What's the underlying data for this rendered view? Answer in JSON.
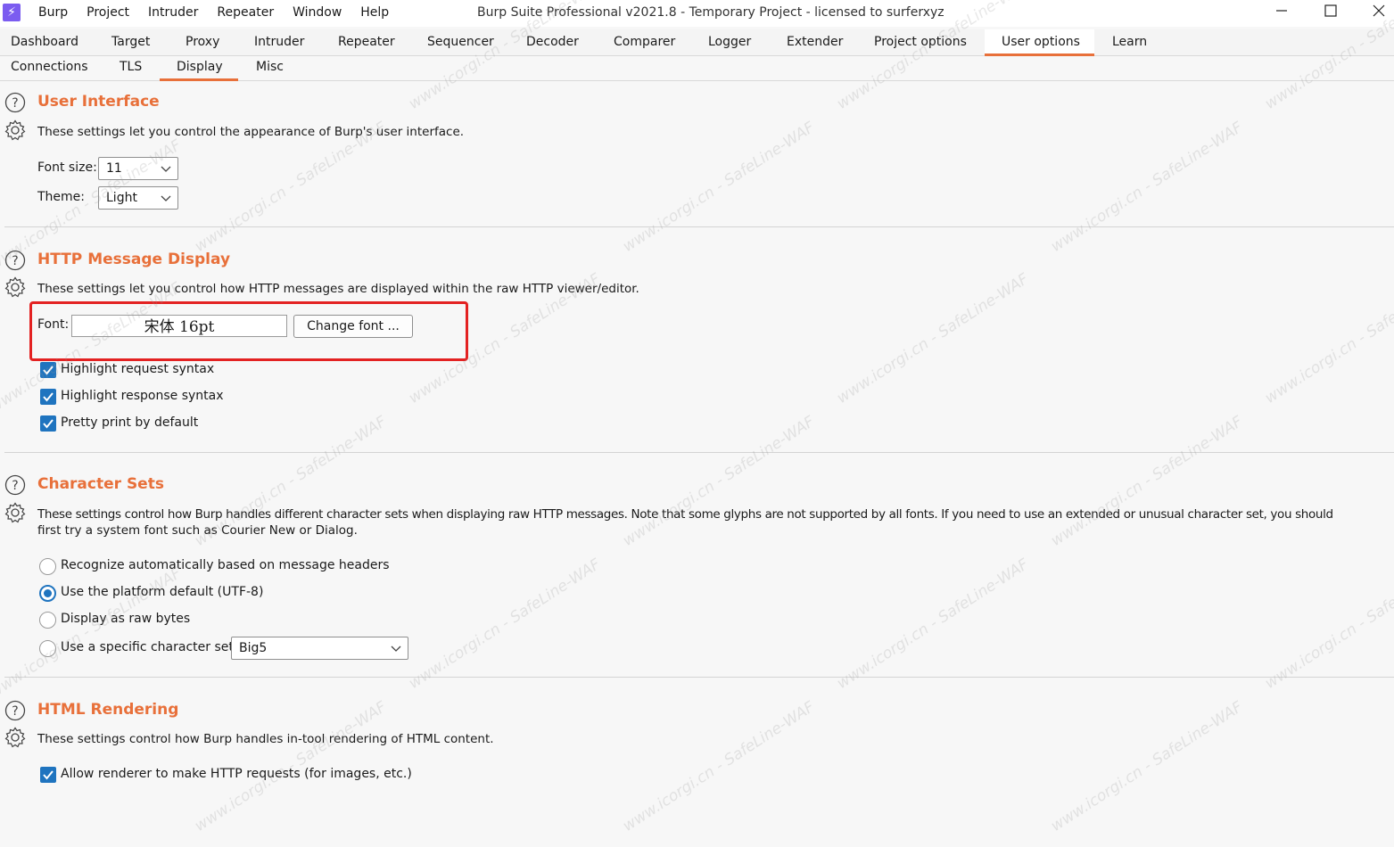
{
  "window": {
    "title": "Burp Suite Professional v2021.8 - Temporary Project - licensed to surferxyz",
    "app_icon": "burp-bolt-icon",
    "controls": [
      "—",
      "☐",
      "✕"
    ]
  },
  "menu": [
    "Burp",
    "Project",
    "Intruder",
    "Repeater",
    "Window",
    "Help"
  ],
  "main_tabs": [
    "Dashboard",
    "Target",
    "Proxy",
    "Intruder",
    "Repeater",
    "Sequencer",
    "Decoder",
    "Comparer",
    "Logger",
    "Extender",
    "Project options",
    "User options",
    "Learn"
  ],
  "main_tabs_active": "User options",
  "sub_tabs": [
    "Connections",
    "TLS",
    "Display",
    "Misc"
  ],
  "sub_tabs_active": "Display",
  "colors": {
    "accent": "#e8703a",
    "checkbox": "#1f74bf",
    "highlight": "#e32222"
  },
  "user_interface": {
    "title": "User Interface",
    "desc": "These settings let you control the appearance of Burp's user interface.",
    "font_size_label": "Font size:",
    "font_size_value": "11",
    "theme_label": "Theme:",
    "theme_value": "Light"
  },
  "http_display": {
    "title": "HTTP Message Display",
    "desc": "These settings let you control how HTTP messages are displayed within the raw HTTP viewer/editor.",
    "font_label": "Font:",
    "font_value": "宋体 16pt",
    "change_font_label": "Change font ...",
    "options": [
      {
        "label": "Highlight request syntax",
        "checked": true
      },
      {
        "label": "Highlight response syntax",
        "checked": true
      },
      {
        "label": "Pretty print by default",
        "checked": true
      }
    ]
  },
  "charsets": {
    "title": "Character Sets",
    "desc_line1": "These settings control how Burp handles different character sets when displaying raw HTTP messages. Note that some glyphs are not supported by all fonts. If you need to use an extended or unusual character set, you should",
    "desc_line2": "first try a system font such as Courier New or Dialog.",
    "options": [
      {
        "label": "Recognize automatically based on message headers",
        "selected": false
      },
      {
        "label": "Use the platform default (UTF-8)",
        "selected": true
      },
      {
        "label": "Display as raw bytes",
        "selected": false
      },
      {
        "label": "Use a specific character set:",
        "selected": false
      }
    ],
    "charset_value": "Big5"
  },
  "html_rendering": {
    "title": "HTML Rendering",
    "desc": "These settings control how Burp handles in-tool rendering of HTML content.",
    "option": {
      "label": "Allow renderer to make HTTP requests (for images, etc.)",
      "checked": true
    }
  },
  "watermark": "www.icorgi.cn - SafeLine-WAF"
}
